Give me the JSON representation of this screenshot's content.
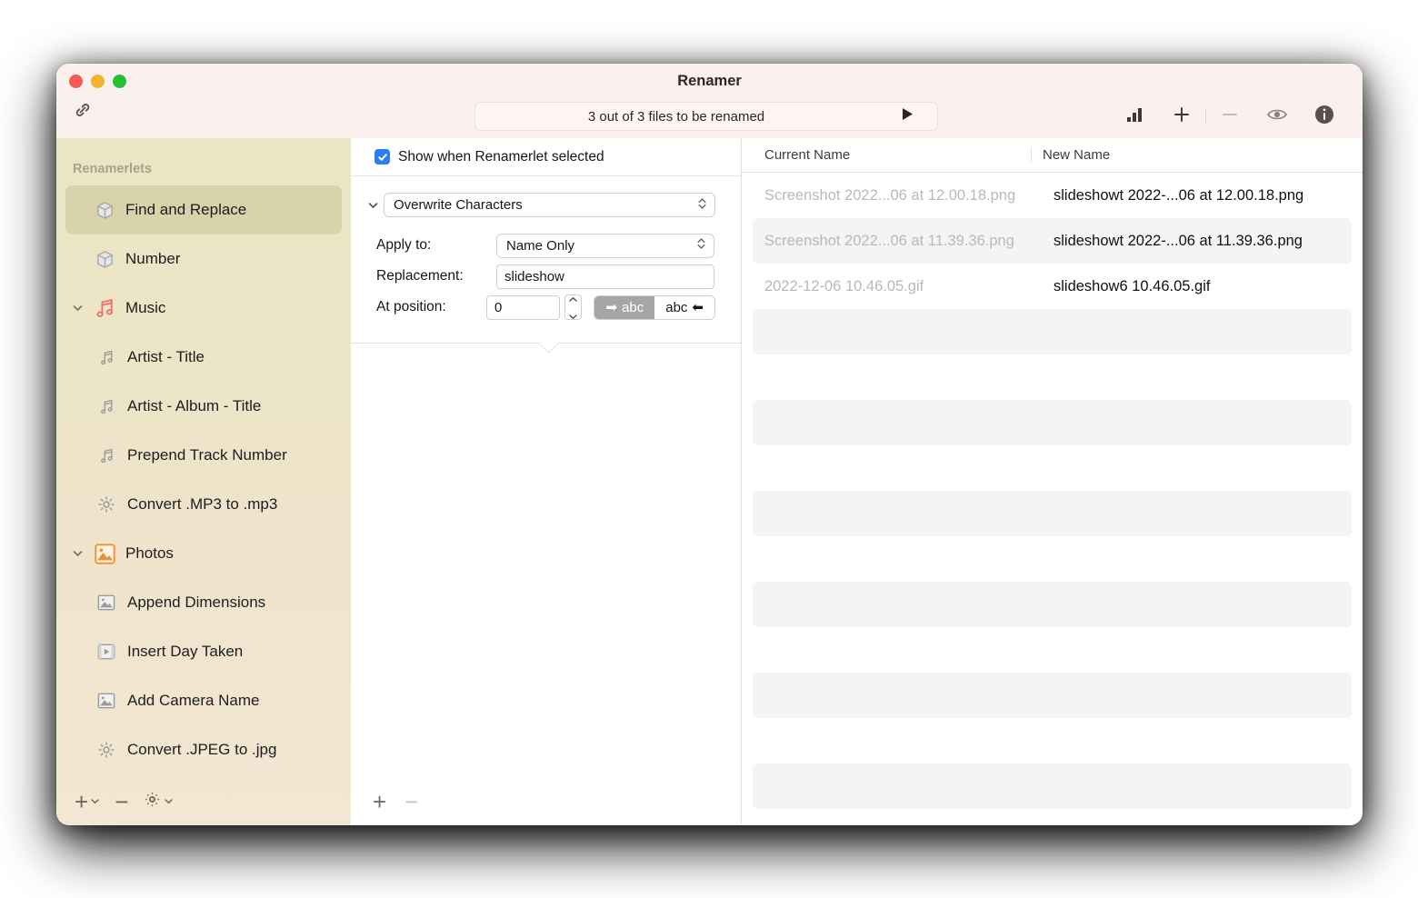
{
  "window": {
    "title": "Renamer",
    "traffic_lights": [
      "close",
      "minimize",
      "zoom"
    ],
    "link_icon": "link-icon"
  },
  "toolbar": {
    "status_text": "3 out of 3 files to be renamed",
    "run_icon": "play-icon",
    "buttons": [
      {
        "name": "stats-button",
        "icon": "bar-chart-icon"
      },
      {
        "name": "add-button",
        "icon": "plus-icon"
      },
      {
        "name": "remove-button",
        "icon": "minus-icon"
      },
      {
        "name": "preview-button",
        "icon": "eye-icon"
      },
      {
        "name": "info-button",
        "icon": "info-circle-icon"
      }
    ]
  },
  "sidebar": {
    "header": "Renamerlets",
    "items": [
      {
        "label": "Find and Replace",
        "icon": "cube-icon",
        "level": 0,
        "selected": true,
        "expandable": false
      },
      {
        "label": "Number",
        "icon": "cube-icon",
        "level": 0,
        "selected": false,
        "expandable": false
      },
      {
        "label": "Music",
        "icon": "music-notes-icon",
        "level": 0,
        "selected": false,
        "expandable": true,
        "expanded": true
      },
      {
        "label": "Artist - Title",
        "icon": "music-note-icon",
        "level": 1,
        "selected": false,
        "expandable": false
      },
      {
        "label": "Artist - Album - Title",
        "icon": "music-note-icon",
        "level": 1,
        "selected": false,
        "expandable": false
      },
      {
        "label": "Prepend Track Number",
        "icon": "music-note-icon",
        "level": 1,
        "selected": false,
        "expandable": false
      },
      {
        "label": "Convert .MP3 to .mp3",
        "icon": "gear-icon",
        "level": 1,
        "selected": false,
        "expandable": false
      },
      {
        "label": "Photos",
        "icon": "photo-icon",
        "level": 0,
        "selected": false,
        "expandable": true,
        "expanded": true
      },
      {
        "label": "Append Dimensions",
        "icon": "image-icon",
        "level": 1,
        "selected": false,
        "expandable": false
      },
      {
        "label": "Insert Day Taken",
        "icon": "filmstrip-icon",
        "level": 1,
        "selected": false,
        "expandable": false
      },
      {
        "label": "Add Camera Name",
        "icon": "image-icon",
        "level": 1,
        "selected": false,
        "expandable": false
      },
      {
        "label": "Convert .JPEG to .jpg",
        "icon": "gear-icon",
        "level": 1,
        "selected": false,
        "expandable": false
      }
    ],
    "footer": {
      "add_label": "+",
      "remove_label": "−",
      "gear_icon": "gear-icon"
    }
  },
  "options": {
    "show_when_selected_label": "Show when Renamerlet selected",
    "show_when_selected_checked": true,
    "module_name": "Overwrite Characters",
    "apply_to_label": "Apply to:",
    "apply_to_value": "Name Only",
    "replacement_label": "Replacement:",
    "replacement_value": "slideshow",
    "at_position_label": "At position:",
    "at_position_value": "0",
    "direction_segments": [
      {
        "label": "abc",
        "arrow": "➡",
        "arrow_side": "left",
        "selected": true
      },
      {
        "label": "abc",
        "arrow": "⬅",
        "arrow_side": "right",
        "selected": false
      }
    ],
    "footer": {
      "add_label": "+",
      "remove_label": "−"
    }
  },
  "filelist": {
    "columns": [
      "Current Name",
      "New Name"
    ],
    "rows": [
      {
        "current": "Screenshot 2022...06 at 12.00.18.png",
        "new": "slideshowt 2022-...06 at 12.00.18.png",
        "alt": false
      },
      {
        "current": "Screenshot 2022...06 at 11.39.36.png",
        "new": "slideshowt 2022-...06 at 11.39.36.png",
        "alt": true
      },
      {
        "current": "2022-12-06 10.46.05.gif",
        "new": "slideshow6 10.46.05.gif",
        "alt": false
      },
      {
        "current": "",
        "new": "",
        "alt": true
      },
      {
        "current": "",
        "new": "",
        "alt": false
      },
      {
        "current": "",
        "new": "",
        "alt": true
      },
      {
        "current": "",
        "new": "",
        "alt": false
      },
      {
        "current": "",
        "new": "",
        "alt": true
      },
      {
        "current": "",
        "new": "",
        "alt": false
      },
      {
        "current": "",
        "new": "",
        "alt": true
      },
      {
        "current": "",
        "new": "",
        "alt": false
      },
      {
        "current": "",
        "new": "",
        "alt": true
      },
      {
        "current": "",
        "new": "",
        "alt": false
      },
      {
        "current": "",
        "new": "",
        "alt": true
      }
    ]
  },
  "colors": {
    "titlebar": "#faf0ed",
    "sidebar_top": "#e9e6c4",
    "sidebar_bottom": "#f3e7d3",
    "selection": "#d9d3ab",
    "checkbox_accent": "#2b7cf6",
    "music_icon": "#f2696f",
    "photo_icon": "#f0912f",
    "row_alt": "#f4f4f4"
  }
}
